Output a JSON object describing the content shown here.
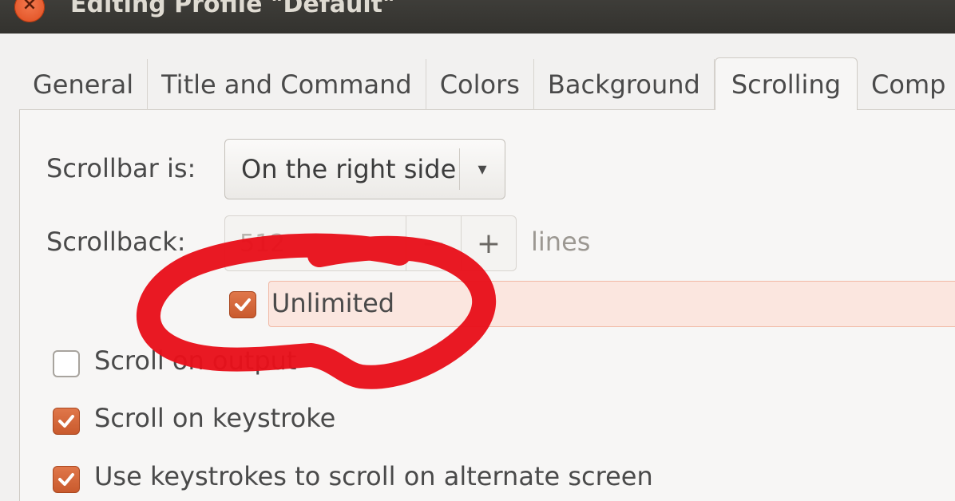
{
  "window": {
    "title": "Editing Profile \"Default\"",
    "close_glyph": "×"
  },
  "tabs": [
    {
      "label": "General",
      "active": false
    },
    {
      "label": "Title and Command",
      "active": false
    },
    {
      "label": "Colors",
      "active": false
    },
    {
      "label": "Background",
      "active": false
    },
    {
      "label": "Scrolling",
      "active": true
    },
    {
      "label": "Comp",
      "active": false
    }
  ],
  "scrollbar": {
    "label": "Scrollbar is:",
    "value": "On the right side",
    "arrow": "▾"
  },
  "scrollback": {
    "label": "Scrollback:",
    "value": "512",
    "minus": "−",
    "plus": "+",
    "unit": "lines"
  },
  "options": {
    "unlimited": {
      "label": "Unlimited",
      "checked": true
    },
    "scroll_on_output": {
      "label": "Scroll on output",
      "checked": false
    },
    "scroll_on_keystroke": {
      "label": "Scroll on keystroke",
      "checked": true
    },
    "alternate_screen": {
      "label": "Use keystrokes to scroll on alternate screen",
      "checked": true
    }
  },
  "colors": {
    "accent": "#d76534",
    "annotation": "#e8101a",
    "titlebar": "#3b3a36"
  }
}
